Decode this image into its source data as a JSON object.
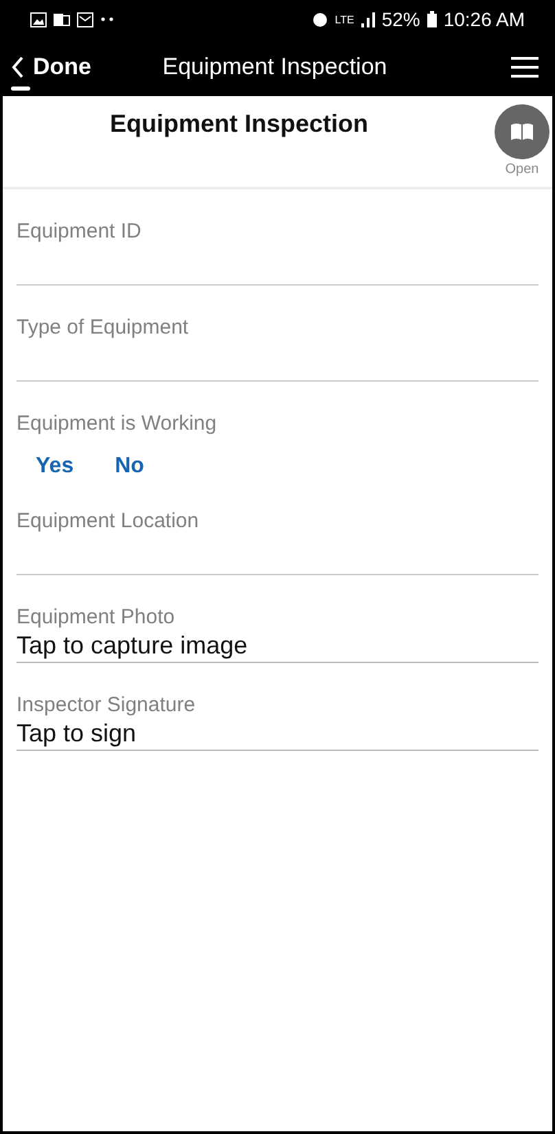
{
  "status_bar": {
    "time": "10:26 AM",
    "battery": "52%",
    "network": "LTE"
  },
  "nav_bar": {
    "back_label": "Done",
    "title": "Equipment Inspection"
  },
  "form": {
    "title": "Equipment Inspection",
    "open_button": {
      "label": "Open"
    },
    "fields": [
      {
        "kind": "text",
        "label": "Equipment ID"
      },
      {
        "kind": "text",
        "label": "Type of Equipment"
      },
      {
        "kind": "choice",
        "label": "Equipment is Working",
        "options": [
          "Yes",
          "No"
        ]
      },
      {
        "kind": "text",
        "label": "Equipment Location"
      },
      {
        "kind": "action",
        "label": "Equipment Photo",
        "value": "Tap to capture image"
      },
      {
        "kind": "action",
        "label": "Inspector Signature",
        "value": "Tap to sign"
      }
    ]
  }
}
